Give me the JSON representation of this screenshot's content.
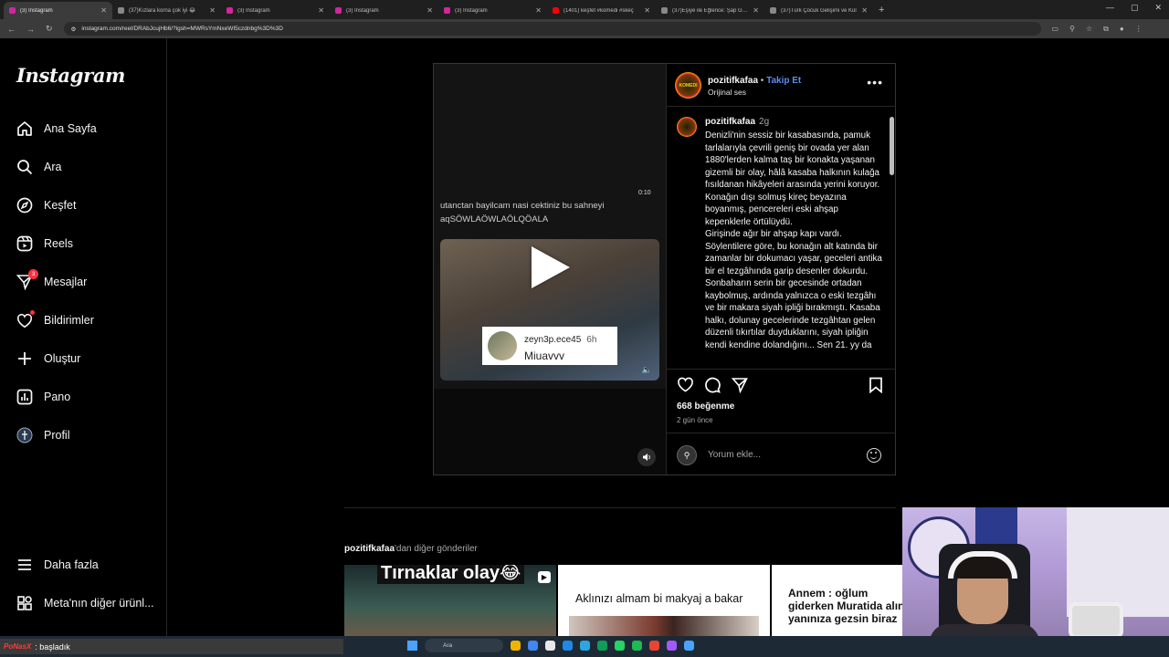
{
  "browser": {
    "tabs": [
      {
        "label": "(3) Instagram",
        "color": "#d6249f",
        "active": true
      },
      {
        "label": "(37)Kızlara korna çok iyi 😂",
        "color": "#888888"
      },
      {
        "label": "(3) Instagram",
        "color": "#d6249f"
      },
      {
        "label": "(3) Instagram",
        "color": "#d6249f"
      },
      {
        "label": "(3) Instagram",
        "color": "#d6249f"
      },
      {
        "label": "(1401) keşfet #komedi #skeç",
        "color": "#ff0000"
      },
      {
        "label": "(37)Eşiye ile Eğlence: Şap Güven",
        "color": "#888888"
      },
      {
        "label": "(37)Türk Çocuk Gelişimi ve Kül",
        "color": "#888888"
      }
    ],
    "new_tab": "+",
    "url": "instagram.com/reel/DRAbJcujHb6/?igsh=MWRsYmNxeWI5czdnbg%3D%3D"
  },
  "sidebar": {
    "logo": "Instagram",
    "items": [
      {
        "label": "Ana Sayfa",
        "icon": "home-icon"
      },
      {
        "label": "Ara",
        "icon": "search-icon"
      },
      {
        "label": "Keşfet",
        "icon": "compass-icon"
      },
      {
        "label": "Reels",
        "icon": "reels-icon"
      },
      {
        "label": "Mesajlar",
        "icon": "messenger-icon",
        "badge": "3"
      },
      {
        "label": "Bildirimler",
        "icon": "heart-icon",
        "dot": true
      },
      {
        "label": "Oluştur",
        "icon": "plus-icon"
      },
      {
        "label": "Pano",
        "icon": "dashboard-icon"
      },
      {
        "label": "Profil",
        "icon": "avatar-icon"
      }
    ],
    "more": "Daha fazla",
    "meta": "Meta'nın diğer ürünl..."
  },
  "post": {
    "video": {
      "overlay_caption": "utanctan bayilcam nasi cektiniz bu sahneyi aqSÖWLAÖWLAÖLQÖALA",
      "time": "0:10",
      "comment_user": "zeyn3p.ece45",
      "comment_time": "6h",
      "comment_text": "Miuavvv"
    },
    "header": {
      "username": "pozitifkafaa",
      "separator": "•",
      "follow": "Takip Et",
      "audio": "Orijinal ses",
      "avatar_text": "KOMEDI"
    },
    "caption": {
      "username": "pozitifkafaa",
      "age": "2g",
      "text": "Denizli'nin sessiz bir kasabasında, pamuk tarlalarıyla çevrili geniş bir ovada yer alan 1880'lerden kalma taş bir konakta yaşanan gizemli bir olay, hâlâ kasaba halkının kulağa fısıldanan hikâyeleri arasında yerini koruyor.\nKonağın dışı solmuş kireç beyazına boyanmış, pencereleri eski ahşap kepenklerle örtülüydü.\nGirişinde ağır bir ahşap kapı vardı. Söylentilere göre, bu konağın alt katında bir zamanlar bir dokumacı yaşar, geceleri antika bir el tezgâhında garip desenler dokurdu. Sonbaharın serin bir gecesinde ortadan kaybolmuş, ardında yalnızca o eski tezgâhı ve bir makara siyah ipliği bırakmıştı. Kasaba halkı, dolunay gecelerinde tezgâhtan gelen düzenli tıkırtılar duyduklarını, siyah ipliğin kendi kendine dolandığını... Sen 21. yy da"
    },
    "likes": "668 beğenme",
    "ago": "2 gün önce",
    "comment_placeholder": "Yorum ekle..."
  },
  "more_posts": {
    "user": "pozitifkafaa",
    "suffix": "'dan diğer gönderiler",
    "thumbs": [
      {
        "text": "Tırnaklar olay😂"
      },
      {
        "text": "Aklınızı almam bi makyaj a bakar"
      },
      {
        "text": "Annem : oğlum giderken Muratida alın yanınıza gezsin biraz"
      }
    ]
  },
  "taskbar": {
    "stream_logo": "PoNasX",
    "stream_text": ": başladık",
    "search_placeholder": "Ara",
    "apps": [
      "#f0b400",
      "#4285f4",
      "#e8e8e8",
      "#1e88e5",
      "#2ca5e0",
      "#0f9d58",
      "#25d366",
      "#1db954",
      "#ea4335",
      "#a259ff",
      "#4aa3ff"
    ]
  }
}
